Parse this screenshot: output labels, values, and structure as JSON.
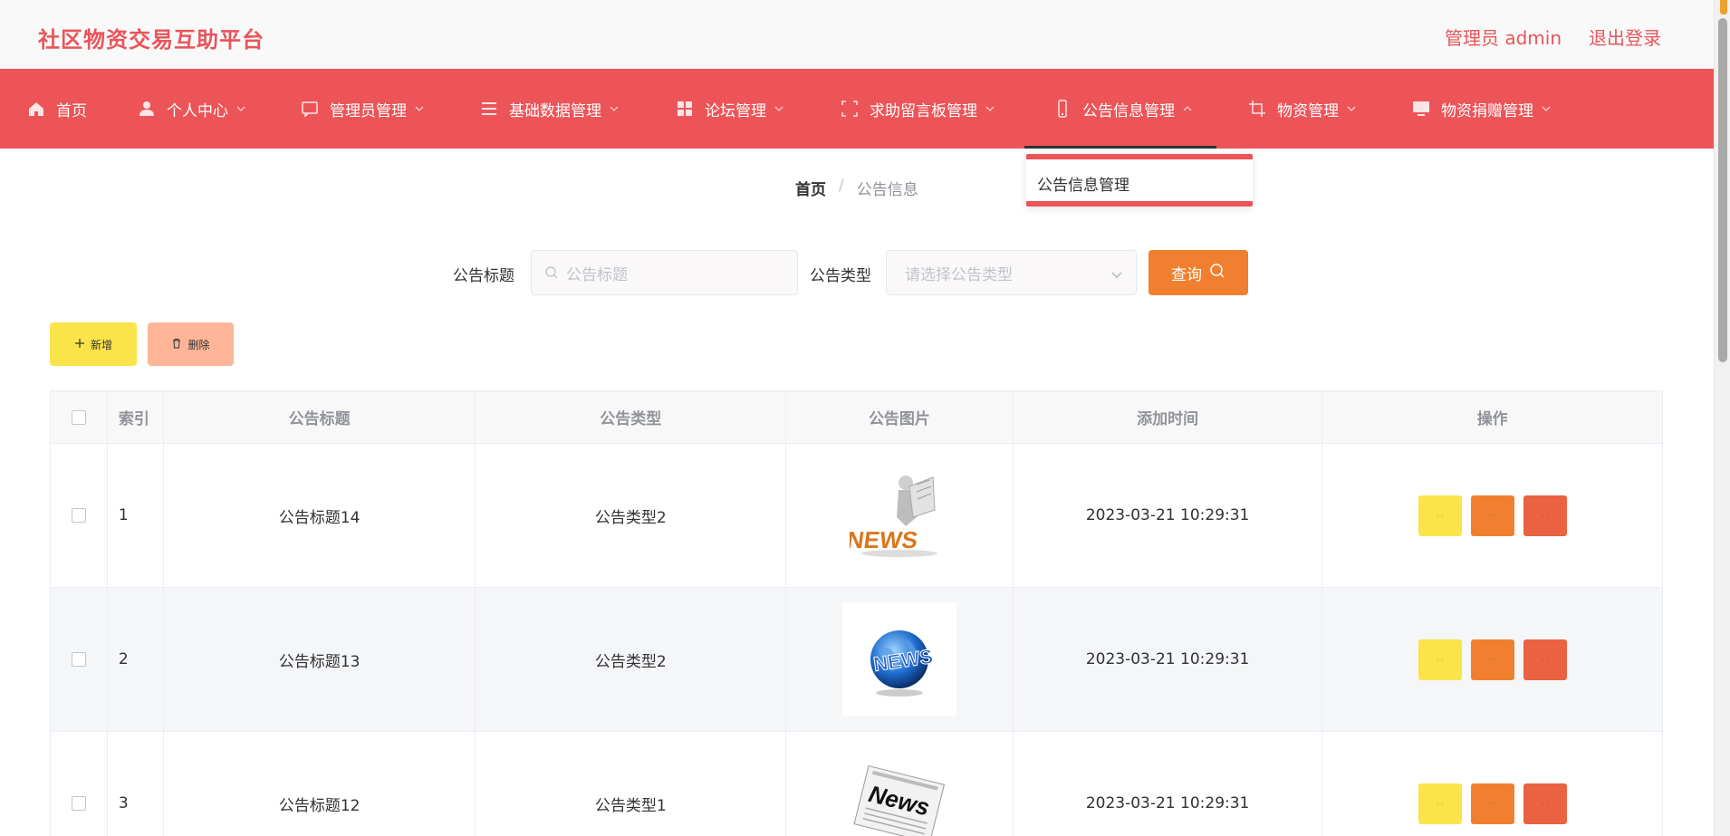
{
  "app": {
    "title": "社区物资交易互助平台"
  },
  "header": {
    "user_label": "管理员 admin",
    "logout_label": "退出登录"
  },
  "nav": {
    "items": [
      {
        "label": "首页",
        "icon": "home-icon"
      },
      {
        "label": "个人中心",
        "icon": "user-icon"
      },
      {
        "label": "管理员管理",
        "icon": "chat-icon"
      },
      {
        "label": "基础数据管理",
        "icon": "list-icon"
      },
      {
        "label": "论坛管理",
        "icon": "grid-icon"
      },
      {
        "label": "求助留言板管理",
        "icon": "frame-icon"
      },
      {
        "label": "公告信息管理",
        "icon": "phone-icon"
      },
      {
        "label": "物资管理",
        "icon": "crop-icon"
      },
      {
        "label": "物资捐赠管理",
        "icon": "monitor-icon"
      }
    ],
    "dropdown_item": "公告信息管理"
  },
  "breadcrumb": {
    "home": "首页",
    "separator": "/",
    "current": "公告信息"
  },
  "search": {
    "title_label": "公告标题",
    "title_placeholder": "公告标题",
    "type_label": "公告类型",
    "type_placeholder": "请选择公告类型",
    "query_label": "查询"
  },
  "actions": {
    "add_label": "新增",
    "delete_label": "删除"
  },
  "table": {
    "columns": [
      "索引",
      "公告标题",
      "公告类型",
      "公告图片",
      "添加时间",
      "操作"
    ],
    "rows": [
      {
        "index": "1",
        "title": "公告标题14",
        "type": "公告类型2",
        "image": "news-reader-image",
        "time": "2023-03-21 10:29:31"
      },
      {
        "index": "2",
        "title": "公告标题13",
        "type": "公告类型2",
        "image": "news-globe-image",
        "time": "2023-03-21 10:29:31"
      },
      {
        "index": "3",
        "title": "公告标题12",
        "type": "公告类型1",
        "image": "newspaper-image",
        "time": "2023-03-21 10:29:31"
      }
    ]
  },
  "colors": {
    "brand": "#e9555a",
    "nav_bg": "#ec5458",
    "query": "#f0802f",
    "add": "#fbe34a",
    "delete": "#ffb598"
  }
}
